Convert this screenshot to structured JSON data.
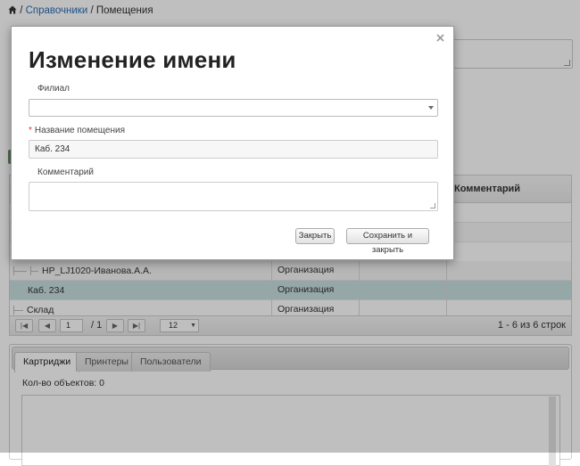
{
  "breadcrumb": {
    "link": "Справочники",
    "separator": " / ",
    "current": "Помещения"
  },
  "grid": {
    "header_comment": "Комментарий",
    "rows": [
      {
        "name": "HP_LJ1020-Иванова.А.А.",
        "type": "Организация"
      },
      {
        "name": "Каб. 234",
        "type": "Организация"
      },
      {
        "name": "Склад",
        "type": "Организация"
      }
    ],
    "pager": {
      "page": "1",
      "total": "/ 1",
      "page_size": "12",
      "info": "1 - 6 из 6 строк"
    }
  },
  "tabs": {
    "items": [
      "Картриджи",
      "Принтеры",
      "Пользователи"
    ],
    "active": "Картриджи",
    "count_label": "Кол-во объектов: 0"
  },
  "modal": {
    "title": "Изменение имени",
    "close_glyph": "×",
    "branch_label": "Филиал",
    "branch_value": "",
    "required_mark": "*",
    "room_label": "Название помещения",
    "room_value": "Каб. 234",
    "comment_label": "Комментарий",
    "comment_value": "",
    "close_button": "Закрыть",
    "save_button": "Сохранить и закрыть"
  },
  "colors": {
    "link": "#2a6fb5",
    "selected_row": "#c9dfe1",
    "required": "#dd3333"
  }
}
